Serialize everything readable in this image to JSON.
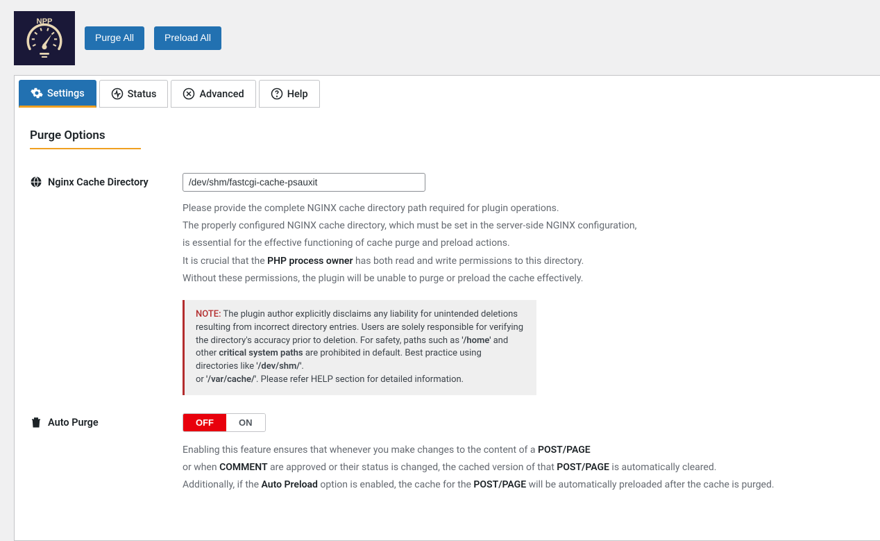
{
  "header": {
    "logo_label": "NPP",
    "purge_all": "Purge All",
    "preload_all": "Preload All"
  },
  "tabs": {
    "settings": "Settings",
    "status": "Status",
    "advanced": "Advanced",
    "help": "Help"
  },
  "section": {
    "title": "Purge Options"
  },
  "cache_dir": {
    "label": "Nginx Cache Directory",
    "value": "/dev/shm/fastcgi-cache-psauxit",
    "help1": "Please provide the complete NGINX cache directory path required for plugin operations.",
    "help2": "The properly configured NGINX cache directory, which must be set in the server-side NGINX configuration,",
    "help3": "is essential for the effective functioning of cache purge and preload actions.",
    "help4a": "It is crucial that the ",
    "help4b": "PHP process owner",
    "help4c": " has both read and write permissions to this directory.",
    "help5": "Without these permissions, the plugin will be unable to purge or preload the cache effectively."
  },
  "note": {
    "label": "NOTE:",
    "t1": " The plugin author explicitly disclaims any liability for unintended deletions resulting from incorrect directory entries. Users are solely responsible for verifying the directory's accuracy prior to deletion. For safety, paths such as ",
    "b1": "'/home'",
    "t2": " and other ",
    "b2": "critical system paths",
    "t3": " are prohibited in default. Best practice using directories like ",
    "b3": "'/dev/shm/'",
    "t4": ".",
    "t5": "or ",
    "b4": "'/var/cache/'",
    "t6": ". Please refer HELP section for detailed information."
  },
  "auto_purge": {
    "label": "Auto Purge",
    "off": "OFF",
    "on": "ON",
    "help1a": "Enabling this feature ensures that whenever you make changes to the content of a ",
    "help1b": "POST/PAGE",
    "help2a": "or when ",
    "help2b": "COMMENT",
    "help2c": " are approved or their status is changed, the cached version of that ",
    "help2d": "POST/PAGE",
    "help2e": " is automatically cleared.",
    "help3a": "Additionally, if the ",
    "help3b": "Auto Preload",
    "help3c": " option is enabled, the cache for the ",
    "help3d": "POST/PAGE",
    "help3e": " will be automatically preloaded after the cache is purged."
  }
}
